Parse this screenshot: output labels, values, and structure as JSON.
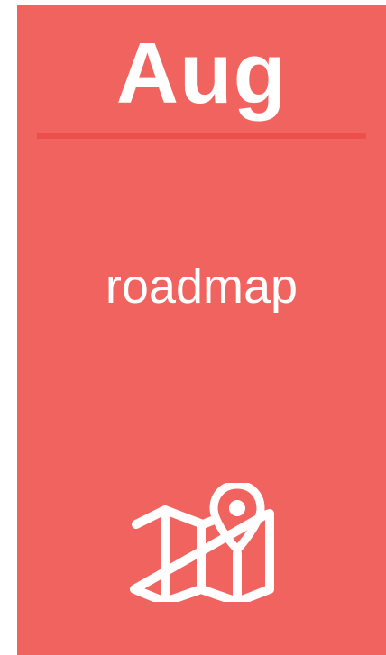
{
  "card": {
    "month": "Aug",
    "label": "roadmap",
    "icon": "map-pin-icon",
    "background_color": "#f1635f",
    "divider_color": "#ec4f4c",
    "text_color": "#ffffff"
  }
}
